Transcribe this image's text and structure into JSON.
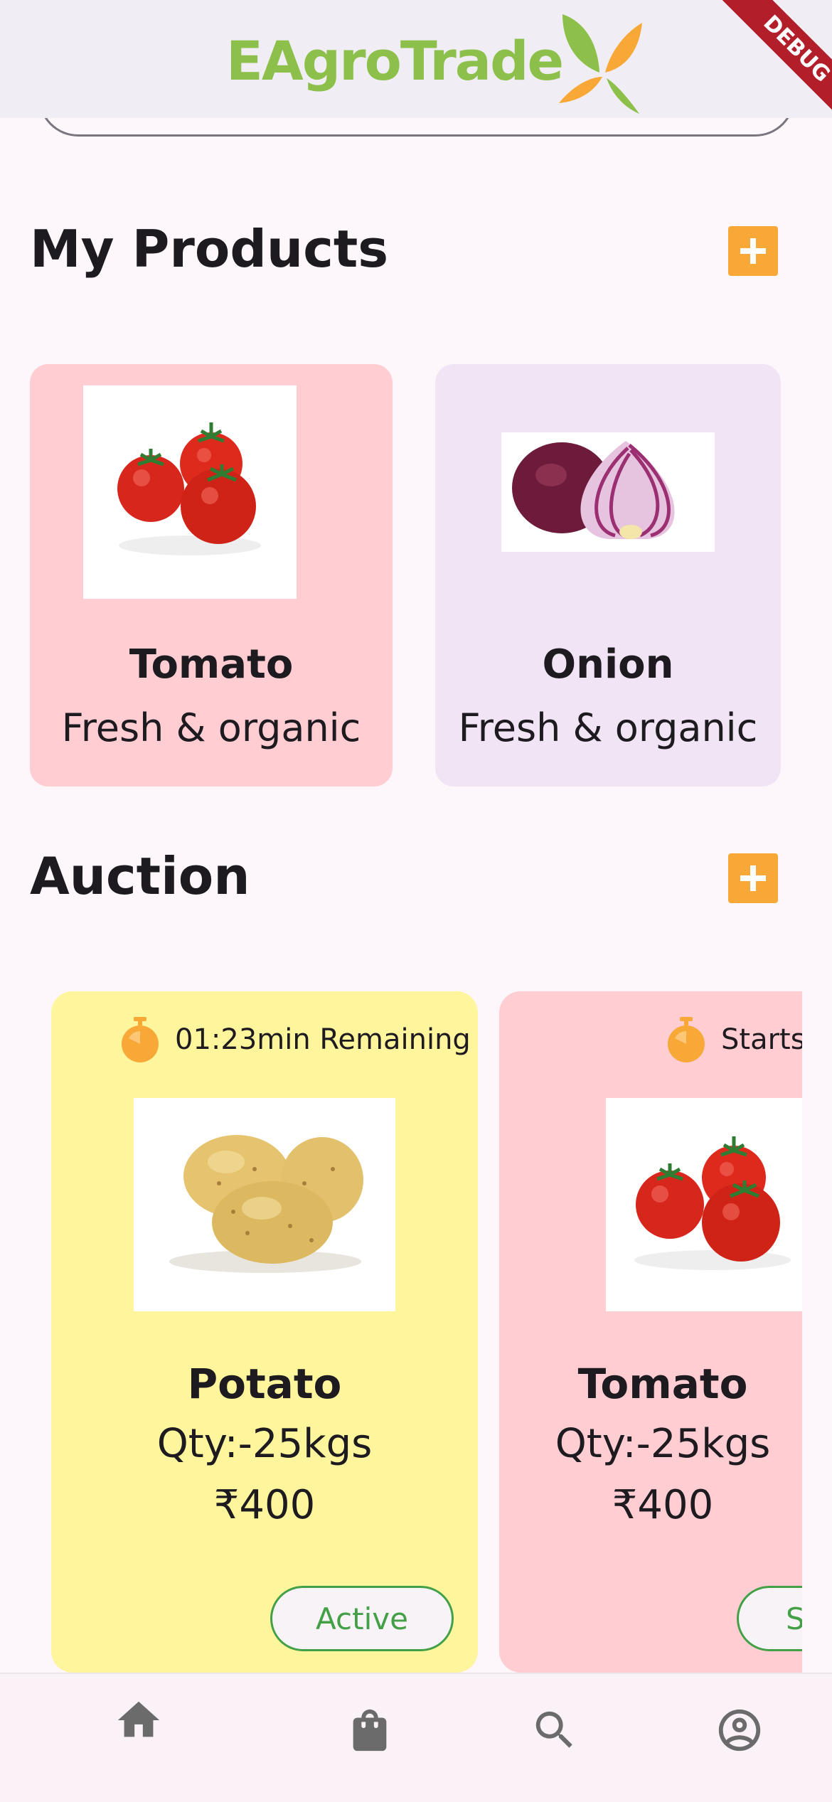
{
  "app": {
    "title": "EAgroTrade",
    "debug_label": "DEBUG"
  },
  "colors": {
    "brand_green": "#8cc04a",
    "accent_orange": "#f8a836",
    "card_pink": "#ffcdd2",
    "card_lavender": "#f1e4f5",
    "card_yellow": "#fff59d",
    "active_green": "#43a047"
  },
  "my_products": {
    "title": "My Products",
    "add_icon": "add-box-icon",
    "items": [
      {
        "name": "Tomato",
        "subtitle": "Fresh & organic",
        "image": "tomatoes"
      },
      {
        "name": "Onion",
        "subtitle": "Fresh & organic",
        "image": "red-onion"
      }
    ]
  },
  "auction": {
    "title": "Auction",
    "add_icon": "add-box-icon",
    "items": [
      {
        "timer_text": "01:23min Remaining",
        "name": "Potato",
        "qty": "Qty:-25kgs",
        "price": "₹400",
        "status": "Active",
        "image": "potatoes"
      },
      {
        "timer_text": "Starts",
        "name": "Tomato",
        "qty": "Qty:-25kgs",
        "price": "₹400",
        "status": "S",
        "image": "tomatoes"
      }
    ]
  },
  "bottom_nav": {
    "items": [
      "home-icon",
      "shopping-bag-icon",
      "search-icon",
      "account-circle-icon"
    ]
  }
}
